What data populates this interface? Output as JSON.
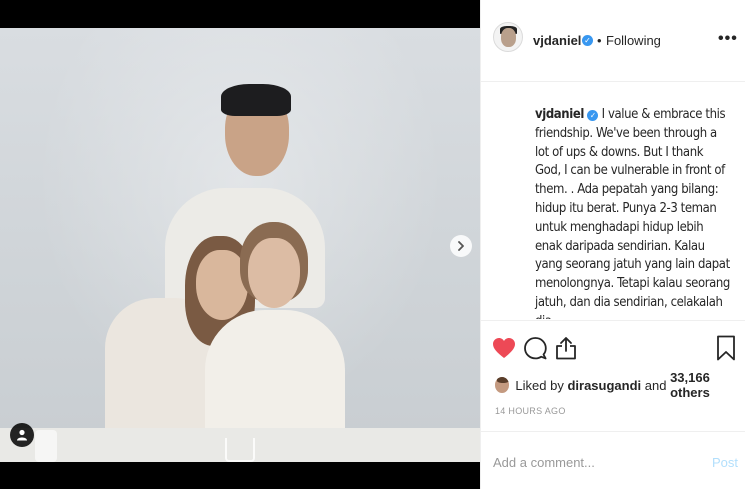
{
  "post": {
    "username": "vjdaniel",
    "follow_status": "Following",
    "separator": "•",
    "more": "•••",
    "caption_user": "vjdaniel",
    "caption_text": "I value & embrace this friendship. We've been through a lot of ups & downs. But I thank God, I can be vulnerable in front of them. . Ada pepatah yang bilang: hidup itu berat. Punya 2-3 teman untuk menghadapi hidup lebih enak daripada sendirian. Kalau yang seorang jatuh yang lain dapat menolongnya. Tetapi kalau seorang jatuh, dan dia sendirian, celakalah dia,",
    "liked_prefix": "Liked by ",
    "liked_user": "dirasugandi",
    "liked_and": " and ",
    "liked_count": "33,166 others",
    "timestamp": "14 HOURS AGO"
  },
  "comment": {
    "placeholder": "Add a comment...",
    "post_label": "Post"
  },
  "icons": {
    "like": "heart-icon",
    "comment": "comment-icon",
    "share": "share-icon",
    "save": "bookmark-icon",
    "next": "chevron-right-icon",
    "tags": "user-tag-icon",
    "verified": "verified-badge-icon"
  },
  "colors": {
    "like_active": "#ed4956",
    "verified": "#3897f0",
    "post_disabled": "#b2dffc",
    "text": "#262626",
    "muted": "#999999"
  }
}
